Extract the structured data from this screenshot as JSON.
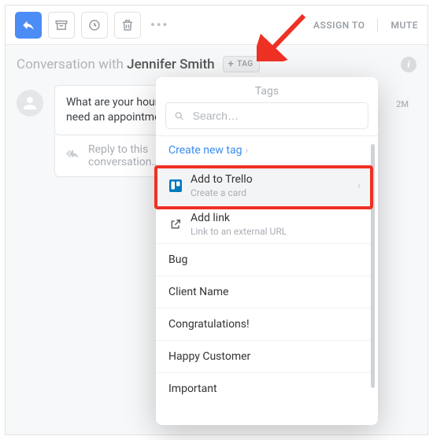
{
  "toolbar": {
    "assign_label": "ASSIGN TO",
    "mute_label": "MUTE"
  },
  "header": {
    "prefix": "Conversation with ",
    "name": "Jennifer Smith",
    "tag_button": "TAG"
  },
  "message": {
    "text": "What are your hours/do I need an appointment?",
    "time": "2M"
  },
  "reply": {
    "placeholder": "Reply to this conversation…"
  },
  "popover": {
    "title": "Tags",
    "search_placeholder": "Search…",
    "create_label": "Create new tag",
    "items": [
      {
        "label": "Add to Trello",
        "sub": "Create a card"
      },
      {
        "label": "Add link",
        "sub": "Link to an external URL"
      },
      {
        "label": "Bug"
      },
      {
        "label": "Client Name"
      },
      {
        "label": "Congratulations!"
      },
      {
        "label": "Happy Customer"
      },
      {
        "label": "Important"
      }
    ]
  }
}
